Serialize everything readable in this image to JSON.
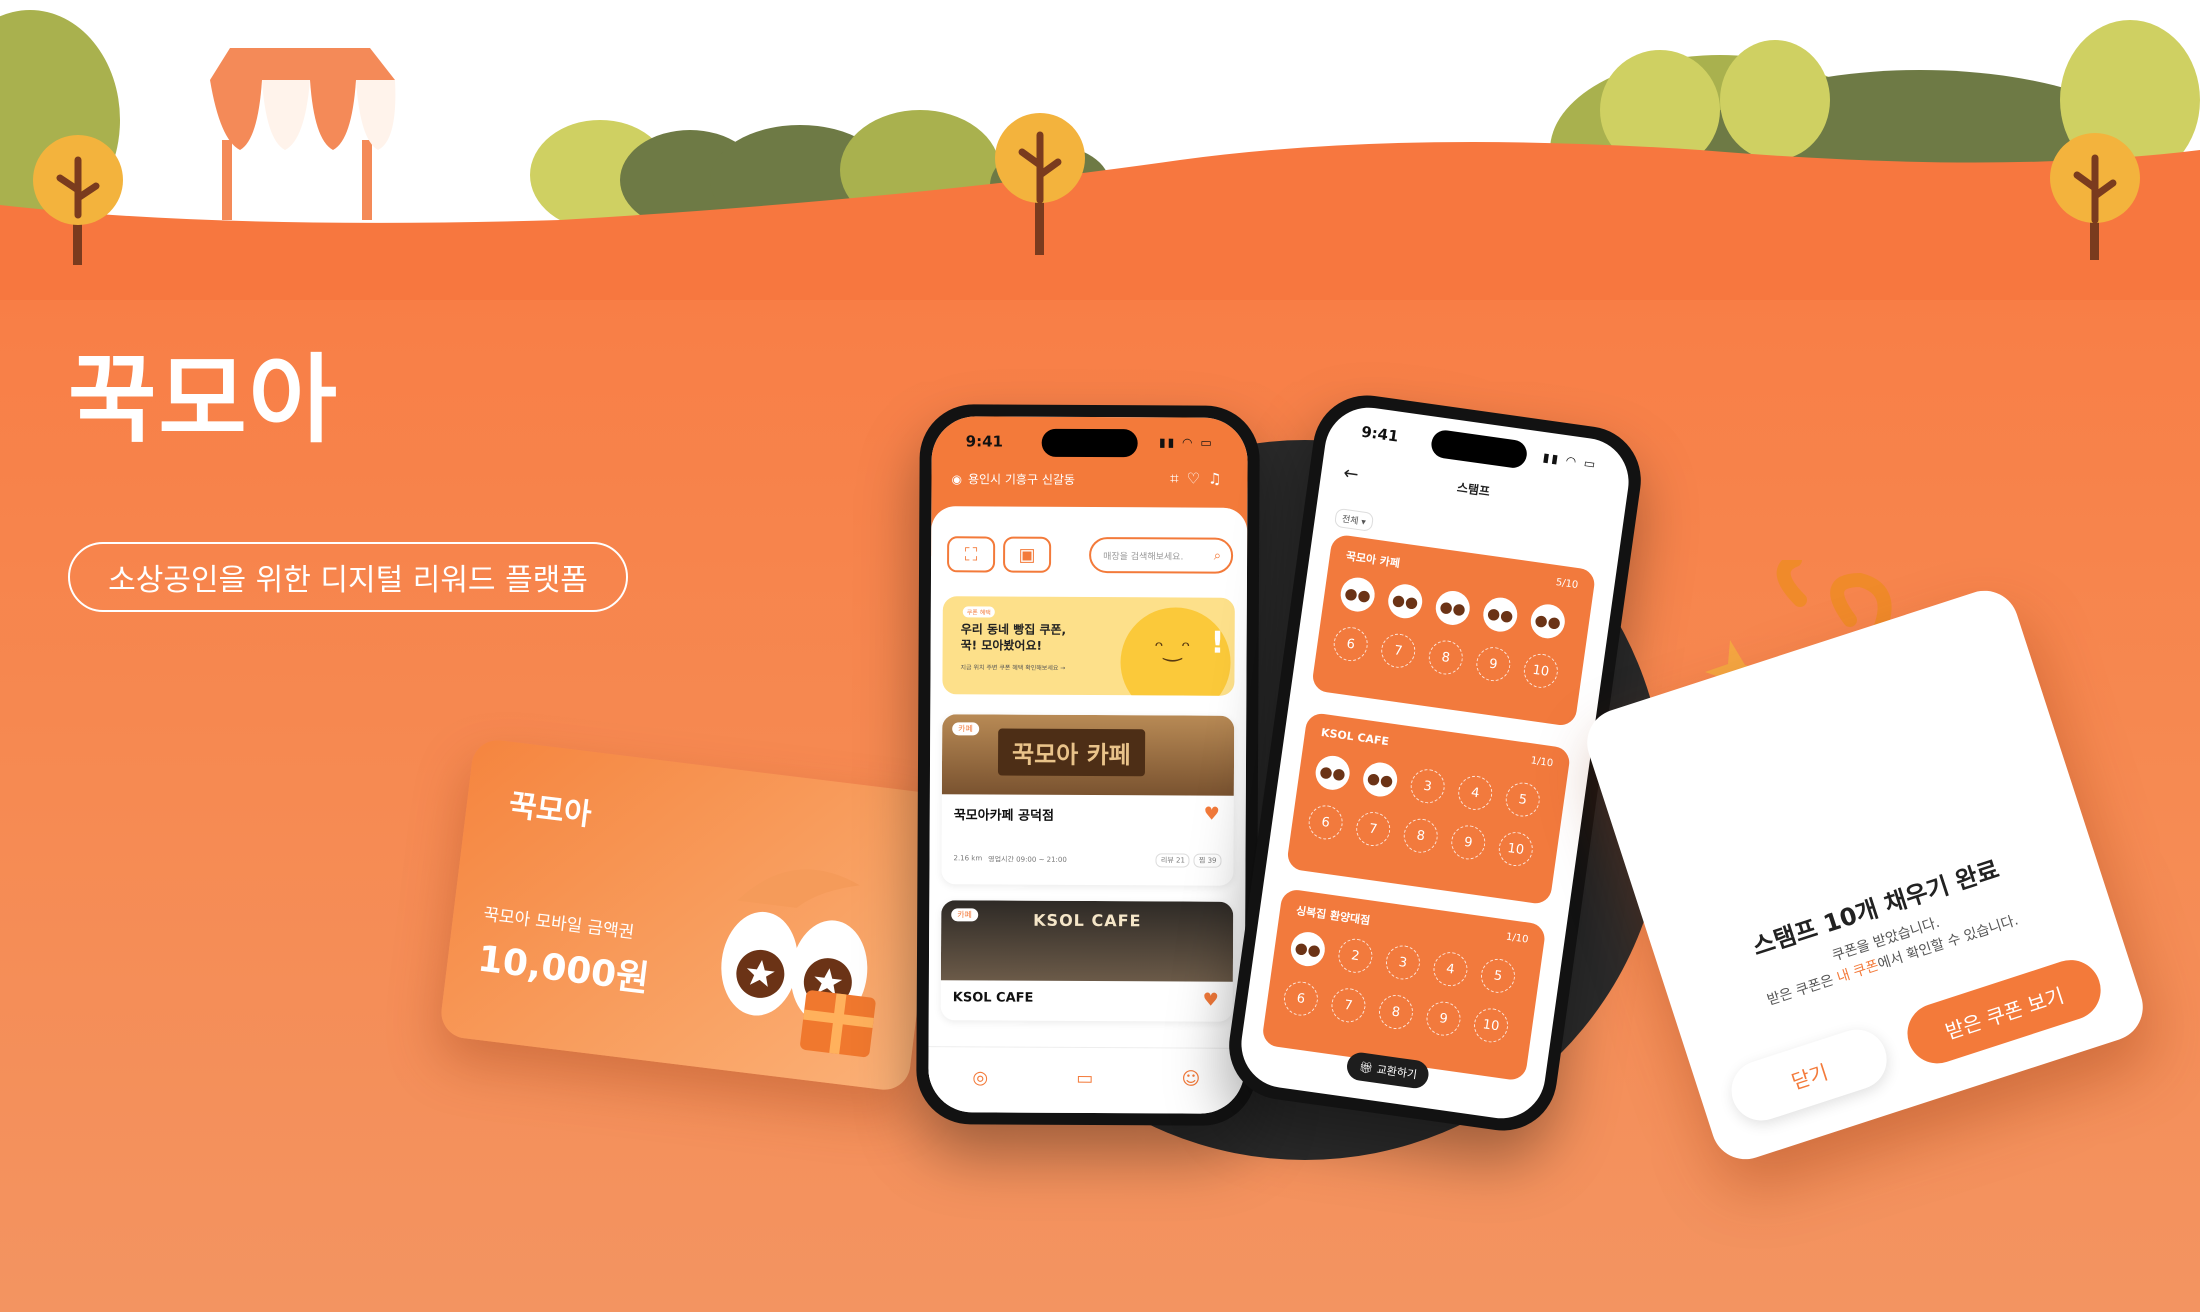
{
  "brand": {
    "logo": "꾹모아",
    "tagline": "소상공인을 위한 디지털 리워드 플랫폼"
  },
  "colors": {
    "accent": "#f37a3a",
    "dark_circle": "#2b2b2b",
    "soft_yellow": "#fde08a"
  },
  "gift_card": {
    "logo": "꾹모아",
    "title": "꾹모아 모바일 금액권",
    "amount": "10,000원"
  },
  "phone_home": {
    "time": "9:41",
    "location": "용인시 기흥구 신갈동",
    "search_placeholder": "매장을 검색해보세요.",
    "banner": {
      "tag": "쿠폰 혜택",
      "line1": "우리 동네 빵집 쿠폰,",
      "line2": "꾹! 모아봤어요!",
      "sub": "지금 위치 주변 쿠폰 혜택 확인해보세요 →"
    },
    "stores": [
      {
        "tag": "카페",
        "sign": "꾹모아 카페",
        "name": "꾹모아카페 공덕점",
        "distance": "2.16 km",
        "hours": "영업시간 09:00 ~ 21:00",
        "review": "리뷰 21",
        "likes": "찜 39"
      },
      {
        "tag": "카페",
        "sign": "KSOL CAFE",
        "name": "KSOL CAFE"
      }
    ]
  },
  "phone_stamp": {
    "time": "9:41",
    "title": "스탬프",
    "filter": "전체",
    "cards": [
      {
        "name": "꾹모아 카페",
        "count": "5/10",
        "filled": 5
      },
      {
        "name": "KSOL CAFE",
        "count": "1/10",
        "filled": 2
      },
      {
        "name": "싱복집 환양대점",
        "count": "1/10",
        "filled": 1
      }
    ],
    "exchange": "교환하기"
  },
  "dialog": {
    "title": "스탬프 10개 채우기 완료",
    "line1": "쿠폰을 받았습니다.",
    "line2a": "받은 쿠폰은 ",
    "line2b": "내 쿠폰",
    "line2c": "에서 확인할 수 있습니다.",
    "close": "닫기",
    "view": "받은 쿠폰 보기"
  }
}
